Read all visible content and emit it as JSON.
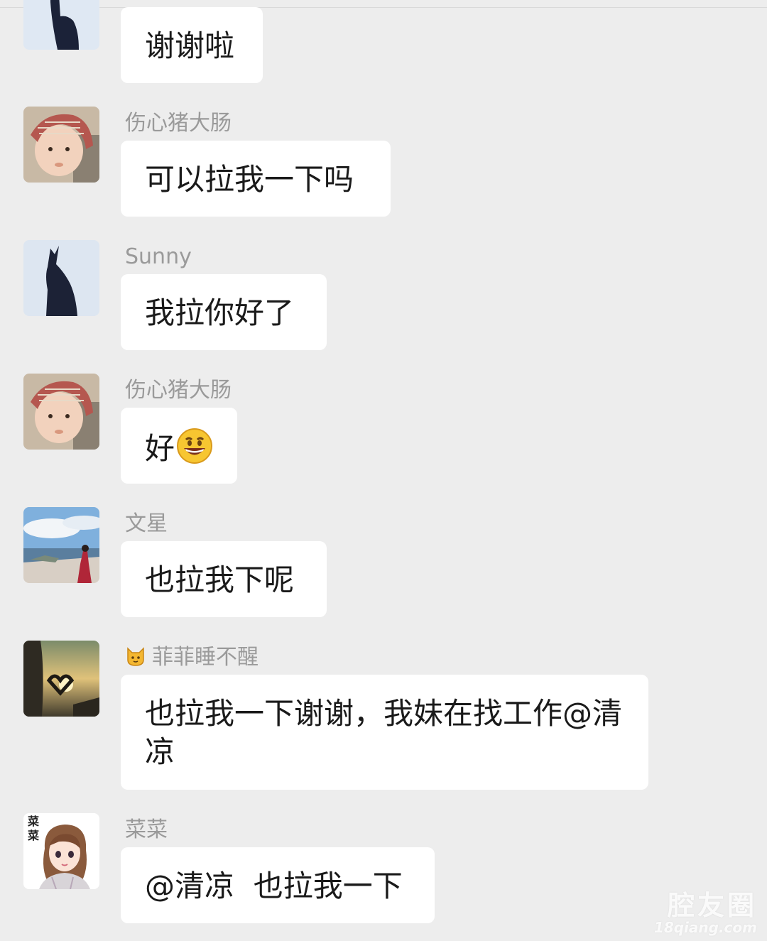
{
  "messages": [
    {
      "sender": "",
      "text": "谢谢啦",
      "avatar": "silhouette-avatar"
    },
    {
      "sender": "伤心猪大肠",
      "text": "可以拉我一下吗",
      "avatar": "baby-avatar"
    },
    {
      "sender": "Sunny",
      "text": "我拉你好了",
      "avatar": "silhouette-avatar"
    },
    {
      "sender": "伤心猪大肠",
      "text": "好",
      "emoji": "grinning-face-emoji",
      "avatar": "baby-avatar"
    },
    {
      "sender": "文星",
      "text": "也拉我下呢",
      "avatar": "landscape-avatar"
    },
    {
      "sender_prefix_icon": "cat-face-icon",
      "sender": "菲菲睡不醒",
      "text": "也拉我一下谢谢，我妹在找工作@清凉",
      "avatar": "sunset-heart-avatar"
    },
    {
      "sender": "菜菜",
      "text": "@清凉  也拉我一下",
      "avatar": "cartoon-girl-avatar",
      "avatar_text": "菜菜"
    }
  ],
  "watermark": {
    "main": "腔友圈",
    "sub": "18qiang.com"
  },
  "colors": {
    "background": "#ededed",
    "bubble": "#ffffff",
    "sender_name": "#9a9a9a",
    "text": "#1a1a1a"
  }
}
